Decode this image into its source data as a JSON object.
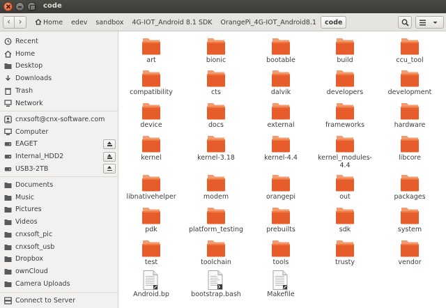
{
  "window": {
    "title": "code"
  },
  "toolbar": {
    "breadcrumbs": [
      "Home",
      "edev",
      "sandbox",
      "4G-IOT_Android 8.1 SDK",
      "OrangePi_4G-IOT_Android8.1",
      "code"
    ]
  },
  "sidebar": {
    "places": [
      "Recent",
      "Home",
      "Desktop",
      "Downloads",
      "Trash",
      "Network"
    ],
    "devices": [
      "cnxsoft@cnx-software.com",
      "Computer",
      "EAGET",
      "Internal_HDD2",
      "USB3-2TB"
    ],
    "bookmarks": [
      "Documents",
      "Music",
      "Pictures",
      "Videos",
      "cnxsoft_pic",
      "cnxsoft_usb",
      "Dropbox",
      "ownCloud",
      "Camera Uploads"
    ],
    "connect": "Connect to Server"
  },
  "files": [
    "art",
    "bionic",
    "bootable",
    "build",
    "ccu_tool",
    "compatibility",
    "cts",
    "dalvik",
    "developers",
    "development",
    "device",
    "docs",
    "external",
    "frameworks",
    "hardware",
    "kernel",
    "kernel-3.18",
    "kernel-4.4",
    "kernel_modules-\n4.4",
    "libcore",
    "libnativehelper",
    "modem",
    "orangepi",
    "out",
    "packages",
    "pdk",
    "platform_testing",
    "prebuilts",
    "sdk",
    "system",
    "test",
    "toolchain",
    "tools",
    "trusty",
    "vendor",
    "Android.bp",
    "bootstrap.bash",
    "Makefile"
  ],
  "colors": {
    "folder_top": "#f39b6d",
    "folder_body": "#e65c2a",
    "accent": "#e95420"
  },
  "icons": {
    "sidebar": [
      "clock-icon",
      "home-icon",
      "folder-icon",
      "download-icon",
      "trash-icon",
      "network-icon",
      "account-icon",
      "computer-icon",
      "drive-icon",
      "drive-icon",
      "drive-icon",
      "folder-icon",
      "folder-icon",
      "folder-icon",
      "folder-icon",
      "folder-icon",
      "folder-icon",
      "folder-icon",
      "folder-icon",
      "folder-icon",
      "server-icon"
    ]
  }
}
